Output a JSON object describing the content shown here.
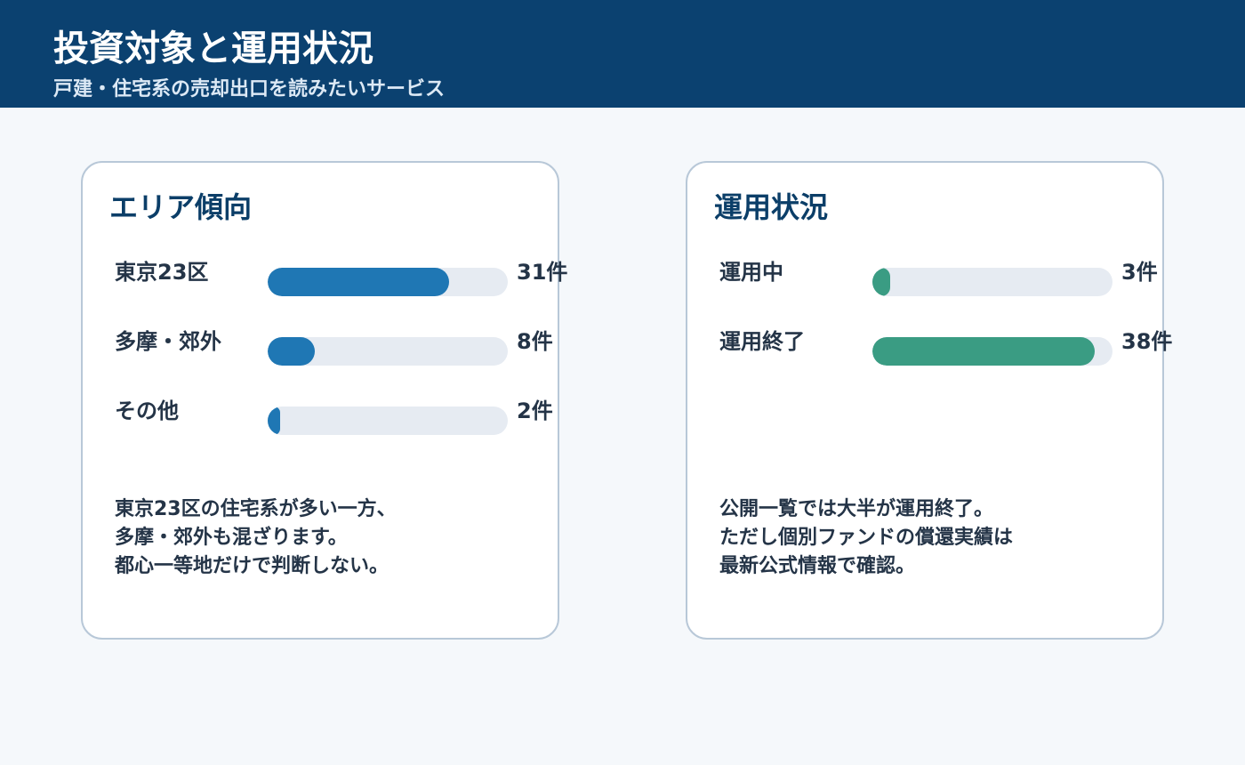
{
  "header": {
    "title": "投資対象と運用状況",
    "subtitle": "戸建・住宅系の売却出口を読みたいサービス"
  },
  "colors": {
    "header_bg": "#0b4170",
    "area_bar": "#1f77b4",
    "status_bar": "#3a9c83",
    "track": "#e6ebf2"
  },
  "chart_data": [
    {
      "type": "bar",
      "orientation": "horizontal",
      "title": "エリア傾向",
      "categories": [
        "東京23区",
        "多摩・郊外",
        "その他"
      ],
      "values": [
        31,
        8,
        2
      ],
      "value_labels": [
        "31件",
        "8件",
        "2件"
      ],
      "xlim": [
        0,
        41
      ],
      "color": "#1f77b4",
      "note_lines": [
        "東京23区の住宅系が多い一方、",
        "多摩・郊外も混ざります。",
        "都心一等地だけで判断しない。"
      ]
    },
    {
      "type": "bar",
      "orientation": "horizontal",
      "title": "運用状況",
      "categories": [
        "運用中",
        "運用終了"
      ],
      "values": [
        3,
        38
      ],
      "value_labels": [
        "3件",
        "38件"
      ],
      "xlim": [
        0,
        41
      ],
      "color": "#3a9c83",
      "note_lines": [
        "公開一覧では大半が運用終了。",
        "ただし個別ファンドの償還実績は",
        "最新公式情報で確認。"
      ]
    }
  ]
}
